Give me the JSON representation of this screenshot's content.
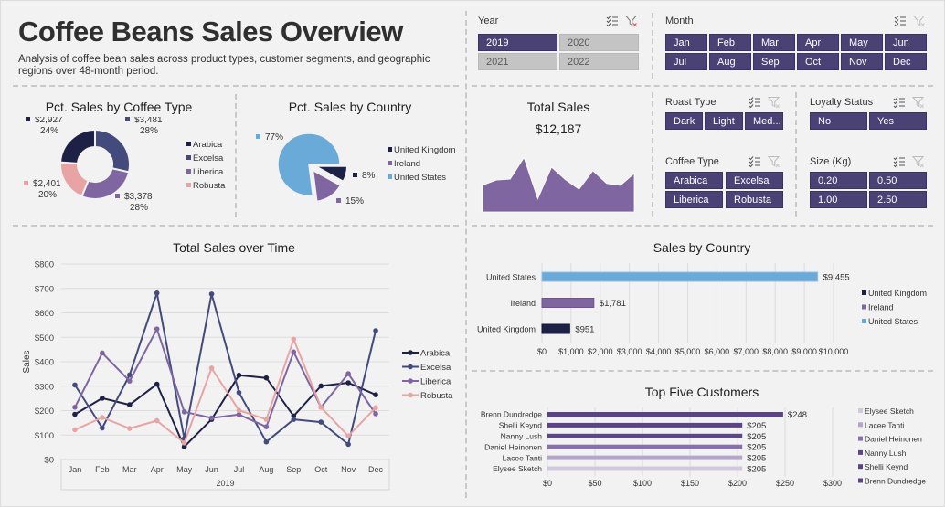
{
  "header": {
    "title": "Coffee Beans Sales Overview",
    "subtitle": "Analysis of coffee bean sales across product types, customer segments, and geographic regions over 48-month period."
  },
  "colors": {
    "arabica": "#1e2146",
    "excelsa": "#434a7c",
    "liberica": "#7f66a0",
    "robusta": "#e8a4a4",
    "united_states": "#6aaad9",
    "ireland": "#7f66a0",
    "united_kingdom": "#1e2146",
    "slicer_selected": "#4a4174",
    "slicer_unselected": "#c4c4c4",
    "sparkline": "#7f66a0"
  },
  "slicers": {
    "year": {
      "title": "Year",
      "options": [
        {
          "label": "2019",
          "selected": true
        },
        {
          "label": "2020",
          "selected": false
        },
        {
          "label": "2021",
          "selected": false
        },
        {
          "label": "2022",
          "selected": false
        }
      ]
    },
    "month": {
      "title": "Month",
      "options": [
        {
          "label": "Jan",
          "selected": true
        },
        {
          "label": "Feb",
          "selected": true
        },
        {
          "label": "Mar",
          "selected": true
        },
        {
          "label": "Apr",
          "selected": true
        },
        {
          "label": "May",
          "selected": true
        },
        {
          "label": "Jun",
          "selected": true
        },
        {
          "label": "Jul",
          "selected": true
        },
        {
          "label": "Aug",
          "selected": true
        },
        {
          "label": "Sep",
          "selected": true
        },
        {
          "label": "Oct",
          "selected": true
        },
        {
          "label": "Nov",
          "selected": true
        },
        {
          "label": "Dec",
          "selected": true
        }
      ]
    },
    "roast_type": {
      "title": "Roast Type",
      "options": [
        {
          "label": "Dark",
          "selected": true
        },
        {
          "label": "Light",
          "selected": true
        },
        {
          "label": "Med...",
          "selected": true
        }
      ]
    },
    "loyalty_status": {
      "title": "Loyalty Status",
      "options": [
        {
          "label": "No",
          "selected": true
        },
        {
          "label": "Yes",
          "selected": true
        }
      ]
    },
    "coffee_type": {
      "title": "Coffee Type",
      "options": [
        {
          "label": "Arabica",
          "selected": true
        },
        {
          "label": "Excelsa",
          "selected": true
        },
        {
          "label": "Liberica",
          "selected": true
        },
        {
          "label": "Robusta",
          "selected": true
        }
      ]
    },
    "size_kg": {
      "title": "Size (Kg)",
      "options": [
        {
          "label": "0.20",
          "selected": true
        },
        {
          "label": "0.50",
          "selected": true
        },
        {
          "label": "1.00",
          "selected": true
        },
        {
          "label": "2.50",
          "selected": true
        }
      ]
    },
    "icons": {
      "multiselect": "multi-select-icon",
      "clear_filter": "clear-filter-icon"
    }
  },
  "kpi": {
    "title": "Total Sales",
    "value": "$12,187"
  },
  "chart_data": [
    {
      "id": "coffee_type_donut",
      "type": "pie",
      "title": "Pct. Sales by Coffee Type",
      "donut": true,
      "slices": [
        {
          "name": "Excelsa",
          "value": 3481,
          "value_label": "$3,481",
          "pct_label": "28%"
        },
        {
          "name": "Liberica",
          "value": 3378,
          "value_label": "$3,378",
          "pct_label": "28%"
        },
        {
          "name": "Robusta",
          "value": 2401,
          "value_label": "$2,401",
          "pct_label": "20%"
        },
        {
          "name": "Arabica",
          "value": 2927,
          "value_label": "$2,927",
          "pct_label": "24%"
        }
      ],
      "legend": [
        "Arabica",
        "Excelsa",
        "Liberica",
        "Robusta"
      ],
      "legend_position": "right"
    },
    {
      "id": "country_pie",
      "type": "pie",
      "title": "Pct. Sales by Country",
      "slices": [
        {
          "name": "United Kingdom",
          "value": 8,
          "pct_label": "8%",
          "exploded": true
        },
        {
          "name": "Ireland",
          "value": 15,
          "pct_label": "15%",
          "exploded": true
        },
        {
          "name": "United States",
          "value": 77,
          "pct_label": "77%",
          "exploded": false
        }
      ],
      "legend": [
        "United Kingdom",
        "Ireland",
        "United States"
      ],
      "legend_position": "right"
    },
    {
      "id": "total_sales_sparkline",
      "type": "area",
      "title": "Total Sales",
      "x": [
        "Jan",
        "Feb",
        "Mar",
        "Apr",
        "May",
        "Jun",
        "Jul",
        "Aug",
        "Sep",
        "Oct",
        "Nov",
        "Dec"
      ],
      "values": [
        826,
        988,
        1018,
        1682,
        401,
        1385,
        1004,
        704,
        1274,
        882,
        823,
        1191
      ],
      "ylim": [
        0,
        1700
      ]
    },
    {
      "id": "sales_over_time",
      "type": "line",
      "title": "Total Sales over Time",
      "xlabel": "2019",
      "ylabel": "Sales",
      "categories": [
        "Jan",
        "Feb",
        "Mar",
        "Apr",
        "May",
        "Jun",
        "Jul",
        "Aug",
        "Sep",
        "Oct",
        "Nov",
        "Dec"
      ],
      "y_ticks": [
        "$0",
        "$100",
        "$200",
        "$300",
        "$400",
        "$500",
        "$600",
        "$700",
        "$800"
      ],
      "ylim": [
        0,
        800
      ],
      "grid": true,
      "legend_position": "right",
      "series": [
        {
          "name": "Arabica",
          "values": [
            185,
            251,
            224,
            308,
            52,
            164,
            345,
            334,
            178,
            301,
            314,
            265
          ]
        },
        {
          "name": "Excelsa",
          "values": [
            305,
            129,
            346,
            681,
            86,
            677,
            274,
            72,
            164,
            153,
            62,
            527
          ]
        },
        {
          "name": "Liberica",
          "values": [
            214,
            436,
            321,
            534,
            195,
            170,
            184,
            134,
            440,
            214,
            351,
            187
          ]
        },
        {
          "name": "Robusta",
          "values": [
            122,
            172,
            127,
            159,
            68,
            374,
            201,
            164,
            492,
            214,
            96,
            212
          ]
        }
      ]
    },
    {
      "id": "sales_by_country",
      "type": "bar",
      "orientation": "horizontal",
      "title": "Sales by Country",
      "categories": [
        "United States",
        "Ireland",
        "United Kingdom"
      ],
      "values": [
        9455,
        1781,
        951
      ],
      "value_labels": [
        "$9,455",
        "$1,781",
        "$951"
      ],
      "x_ticks": [
        "$0",
        "$1,000",
        "$2,000",
        "$3,000",
        "$4,000",
        "$5,000",
        "$6,000",
        "$7,000",
        "$8,000",
        "$9,000",
        "$10,000"
      ],
      "xlim": [
        0,
        10000
      ],
      "grid": true,
      "legend": [
        "United Kingdom",
        "Ireland",
        "United States"
      ],
      "legend_position": "right"
    },
    {
      "id": "top_five_customers",
      "type": "bar",
      "orientation": "horizontal",
      "title": "Top Five Customers",
      "categories": [
        "Brenn Dundredge",
        "Shelli Keynd",
        "Nanny Lush",
        "Daniel Heinonen",
        "Lacee Tanti",
        "Elysee Sketch"
      ],
      "values": [
        248,
        205,
        205,
        205,
        205,
        205
      ],
      "value_labels": [
        "$248",
        "$205",
        "$205",
        "$205",
        "$205",
        "$205"
      ],
      "bar_colors": [
        "#5a4485",
        "#5a4485",
        "#5d4688",
        "#8672a8",
        "#b3a6c8",
        "#d0c9dc"
      ],
      "x_ticks": [
        "$0",
        "$50",
        "$100",
        "$150",
        "$200",
        "$250",
        "$300"
      ],
      "xlim": [
        0,
        300
      ],
      "grid": true,
      "legend": [
        "Elysee Sketch",
        "Lacee Tanti",
        "Daniel Heinonen",
        "Nanny Lush",
        "Shelli Keynd",
        "Brenn Dundredge"
      ],
      "legend_colors": [
        "#d0c9dc",
        "#b3a6c8",
        "#8672a8",
        "#5d4688",
        "#5a4485",
        "#5a4485"
      ],
      "legend_position": "right"
    }
  ]
}
